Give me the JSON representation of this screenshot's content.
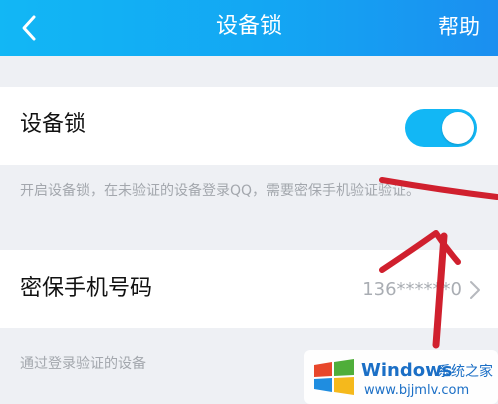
{
  "header": {
    "title": "设备锁",
    "help_label": "帮助",
    "back_icon": "chevron-left-icon"
  },
  "device_lock": {
    "label": "设备锁",
    "toggle_on": true,
    "toggle_color": "#12b7f5",
    "description": "开启设备锁，在未验证的设备登录QQ，需要密保手机验证验证。"
  },
  "phone": {
    "label": "密保手机号码",
    "value": "136******0",
    "chevron_icon": "chevron-right-icon"
  },
  "verified_devices": {
    "description": "通过登录验证的设备"
  },
  "annotation": {
    "color": "#d0202e",
    "shape": "hand-drawn-arrow-pointing-up"
  },
  "watermark": {
    "brand": "Windows",
    "brand_cn": "系统之家",
    "url": "www.bjjmlv.com"
  }
}
